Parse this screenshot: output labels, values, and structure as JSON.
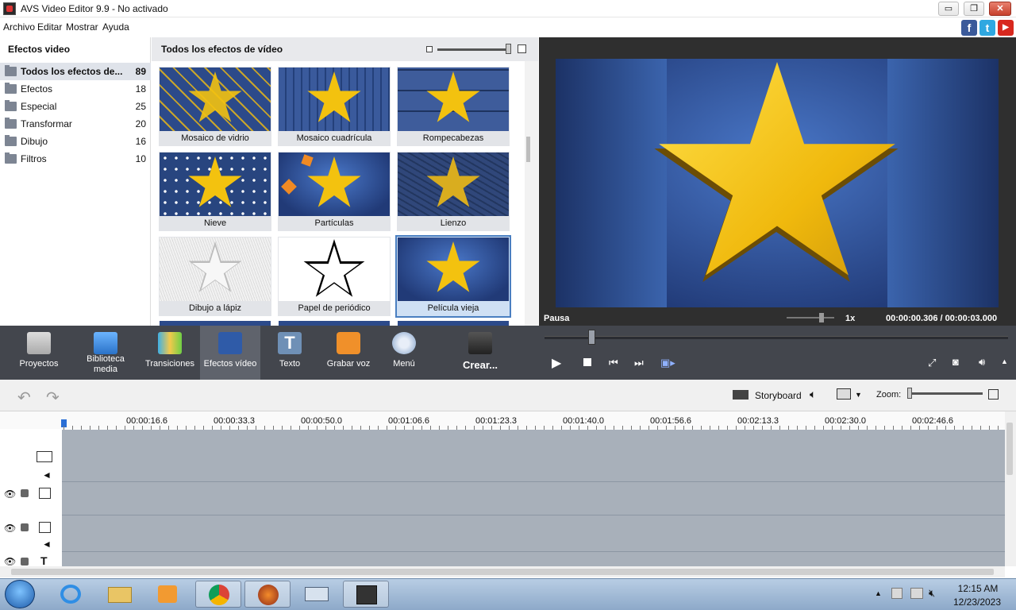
{
  "window": {
    "title": "AVS Video Editor 9.9 - No activado",
    "minimize": "▭",
    "maximize": "❐",
    "close": "✕"
  },
  "menu": [
    "Archivo",
    "Editar",
    "Mostrar",
    "Ayuda"
  ],
  "social": {
    "facebook": "f",
    "twitter": "t",
    "youtube": "▶"
  },
  "left_panel": {
    "header": "Efectos video",
    "categories": [
      {
        "label": "Todos los efectos de...",
        "count": "89"
      },
      {
        "label": "Efectos",
        "count": "18"
      },
      {
        "label": "Especial",
        "count": "25"
      },
      {
        "label": "Transformar",
        "count": "20"
      },
      {
        "label": "Dibujo",
        "count": "16"
      },
      {
        "label": "Filtros",
        "count": "10"
      }
    ]
  },
  "effects_panel": {
    "header": "Todos los efectos de vídeo",
    "tiles": [
      {
        "label": "Mosaico de vidrio"
      },
      {
        "label": "Mosaico cuadrícula"
      },
      {
        "label": "Rompecabezas"
      },
      {
        "label": "Nieve"
      },
      {
        "label": "Partículas"
      },
      {
        "label": "Lienzo"
      },
      {
        "label": "Dibujo a lápiz"
      },
      {
        "label": "Papel de periódico"
      },
      {
        "label": "Película vieja"
      }
    ]
  },
  "preview": {
    "status": "Pausa",
    "speed": "1x",
    "current_time": "00:00:00.306",
    "separator": "/",
    "total_time": "00:00:03.000"
  },
  "toolbar": [
    {
      "label": "Proyectos"
    },
    {
      "label": "Biblioteca media"
    },
    {
      "label": "Transiciones"
    },
    {
      "label": "Efectos vídeo"
    },
    {
      "label": "Texto"
    },
    {
      "label": "Grabar voz"
    },
    {
      "label": "Menú"
    },
    {
      "label": "Crear..."
    }
  ],
  "timeline": {
    "storyboard": "Storyboard",
    "zoom": "Zoom:",
    "ticks": [
      "00:00:16.6",
      "00:00:33.3",
      "00:00:50.0",
      "00:01:06.6",
      "00:01:23.3",
      "00:01:40.0",
      "00:01:56.6",
      "00:02:13.3",
      "00:02:30.0",
      "00:02:46.6"
    ]
  },
  "taskbar": {
    "time": "12:15 AM",
    "date": "12/23/2023"
  },
  "colors": {
    "toolbar_bg": "#43464d",
    "active_tool": "#5f636c",
    "star": "#f3c20f",
    "preview_blue": "#213a77",
    "track_bg": "#a8b0ba"
  }
}
